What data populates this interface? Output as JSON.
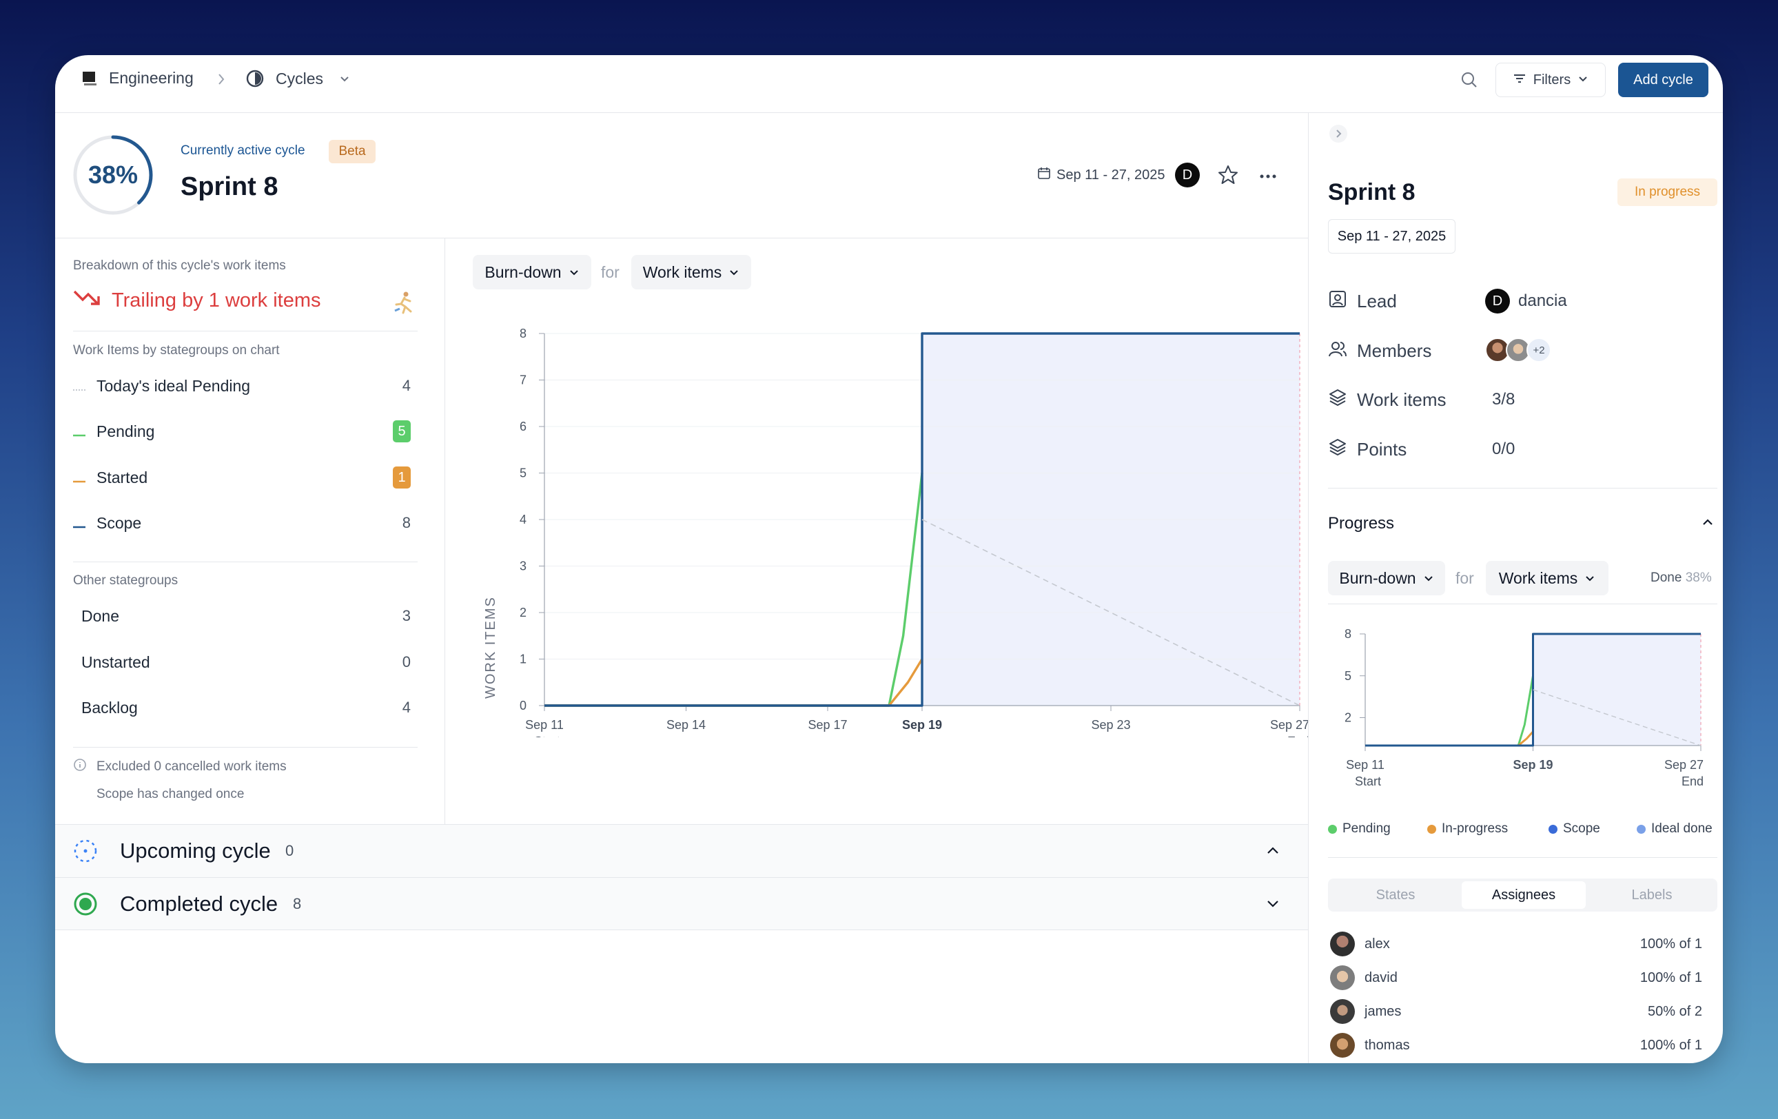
{
  "breadcrumb": {
    "workspace": "Engineering",
    "page": "Cycles"
  },
  "toolbar": {
    "filters_label": "Filters",
    "add_cycle_label": "Add cycle"
  },
  "cycle": {
    "progress_pct": "38%",
    "progress_fraction": 0.38,
    "active_label": "Currently active cycle",
    "beta_label": "Beta",
    "title": "Sprint 8",
    "date_range": "Sep 11 - 27, 2025",
    "lead_initial": "D"
  },
  "breakdown": {
    "heading": "Breakdown of this cycle's work items",
    "trailing_text": "Trailing by 1 work items",
    "stategroups_heading": "Work Items by stategroups on chart",
    "legend": [
      {
        "label": "Today's ideal Pending",
        "count": "4"
      },
      {
        "label": "Pending",
        "count": "5"
      },
      {
        "label": "Started",
        "count": "1"
      },
      {
        "label": "Scope",
        "count": "8"
      }
    ],
    "other_heading": "Other stategroups",
    "other": [
      {
        "label": "Done",
        "count": "3"
      },
      {
        "label": "Unstarted",
        "count": "0"
      },
      {
        "label": "Backlog",
        "count": "4"
      }
    ],
    "excluded_text": "Excluded 0 cancelled work items",
    "scope_text": "Scope has changed once"
  },
  "chart_controls": {
    "type_label": "Burn-down",
    "for_label": "for",
    "metric_label": "Work items"
  },
  "chart_data": [
    {
      "type": "line",
      "ylabel": "WORK ITEMS",
      "ylim": [
        0,
        8
      ],
      "yticks": [
        "0",
        "1",
        "2",
        "3",
        "4",
        "5",
        "6",
        "7",
        "8"
      ],
      "x_ticks": [
        "Sep 11",
        "Sep 14",
        "Sep 17",
        "Sep 19",
        "Sep 23",
        "Sep 27"
      ],
      "x_sublabels": {
        "Sep 11": "Start",
        "Sep 27": "End"
      },
      "highlight_tick": "Sep 19",
      "x_day_offsets": [
        0,
        3,
        6,
        8,
        12,
        16
      ],
      "series": [
        {
          "name": "Pending",
          "color": "#5ccd6b",
          "points": [
            [
              0,
              0
            ],
            [
              7.3,
              0
            ],
            [
              7.6,
              1.5
            ],
            [
              8,
              5
            ]
          ]
        },
        {
          "name": "Started",
          "color": "#e59a3c",
          "points": [
            [
              0,
              0
            ],
            [
              7.3,
              0
            ],
            [
              7.7,
              0.5
            ],
            [
              8,
              1
            ]
          ]
        },
        {
          "name": "Scope",
          "color": "#23588f",
          "points": [
            [
              0,
              0
            ],
            [
              8,
              0
            ],
            [
              8,
              8
            ],
            [
              16,
              8
            ]
          ]
        },
        {
          "name": "Ideal",
          "color": "#c4c8cf",
          "points": [
            [
              8,
              4
            ],
            [
              16,
              0
            ]
          ]
        }
      ]
    },
    {
      "type": "line",
      "ylim": [
        0,
        8
      ],
      "yticks": [
        "2",
        "5",
        "8"
      ],
      "x_ticks": [
        "Sep 11",
        "Sep 19",
        "Sep 27"
      ],
      "x_sublabels": {
        "Sep 11": "Start",
        "Sep 27": "End"
      },
      "highlight_tick": "Sep 19",
      "legend": [
        "Pending",
        "In-progress",
        "Scope",
        "Ideal done"
      ]
    }
  ],
  "sections": {
    "upcoming": {
      "title": "Upcoming cycle",
      "count": "0"
    },
    "completed": {
      "title": "Completed cycle",
      "count": "8"
    }
  },
  "details": {
    "title": "Sprint 8",
    "status": "In progress",
    "date_range": "Sep 11 - 27, 2025",
    "lead_label": "Lead",
    "lead_value": "dancia",
    "lead_initial": "D",
    "members_label": "Members",
    "members_extra": "+2",
    "work_items_label": "Work items",
    "work_items_value": "3/8",
    "points_label": "Points",
    "points_value": "0/0",
    "progress_label": "Progress",
    "chart_type": "Burn-down",
    "for_label": "for",
    "metric": "Work items",
    "done_label": "Done",
    "done_value": "38%",
    "legend": {
      "pending": "Pending",
      "in_progress": "In-progress",
      "scope": "Scope",
      "ideal": "Ideal done"
    },
    "tabs": [
      "States",
      "Assignees",
      "Labels"
    ],
    "assignees": [
      {
        "name": "alex",
        "value": "100% of 1"
      },
      {
        "name": "david",
        "value": "100% of 1"
      },
      {
        "name": "james",
        "value": "50% of 2"
      },
      {
        "name": "thomas",
        "value": "100% of 1"
      }
    ]
  },
  "colors": {
    "accent": "#1b5593",
    "pending": "#5ccd6b",
    "started": "#e59a3c",
    "scope": "#23588f",
    "trailing": "#dc3e3e"
  }
}
